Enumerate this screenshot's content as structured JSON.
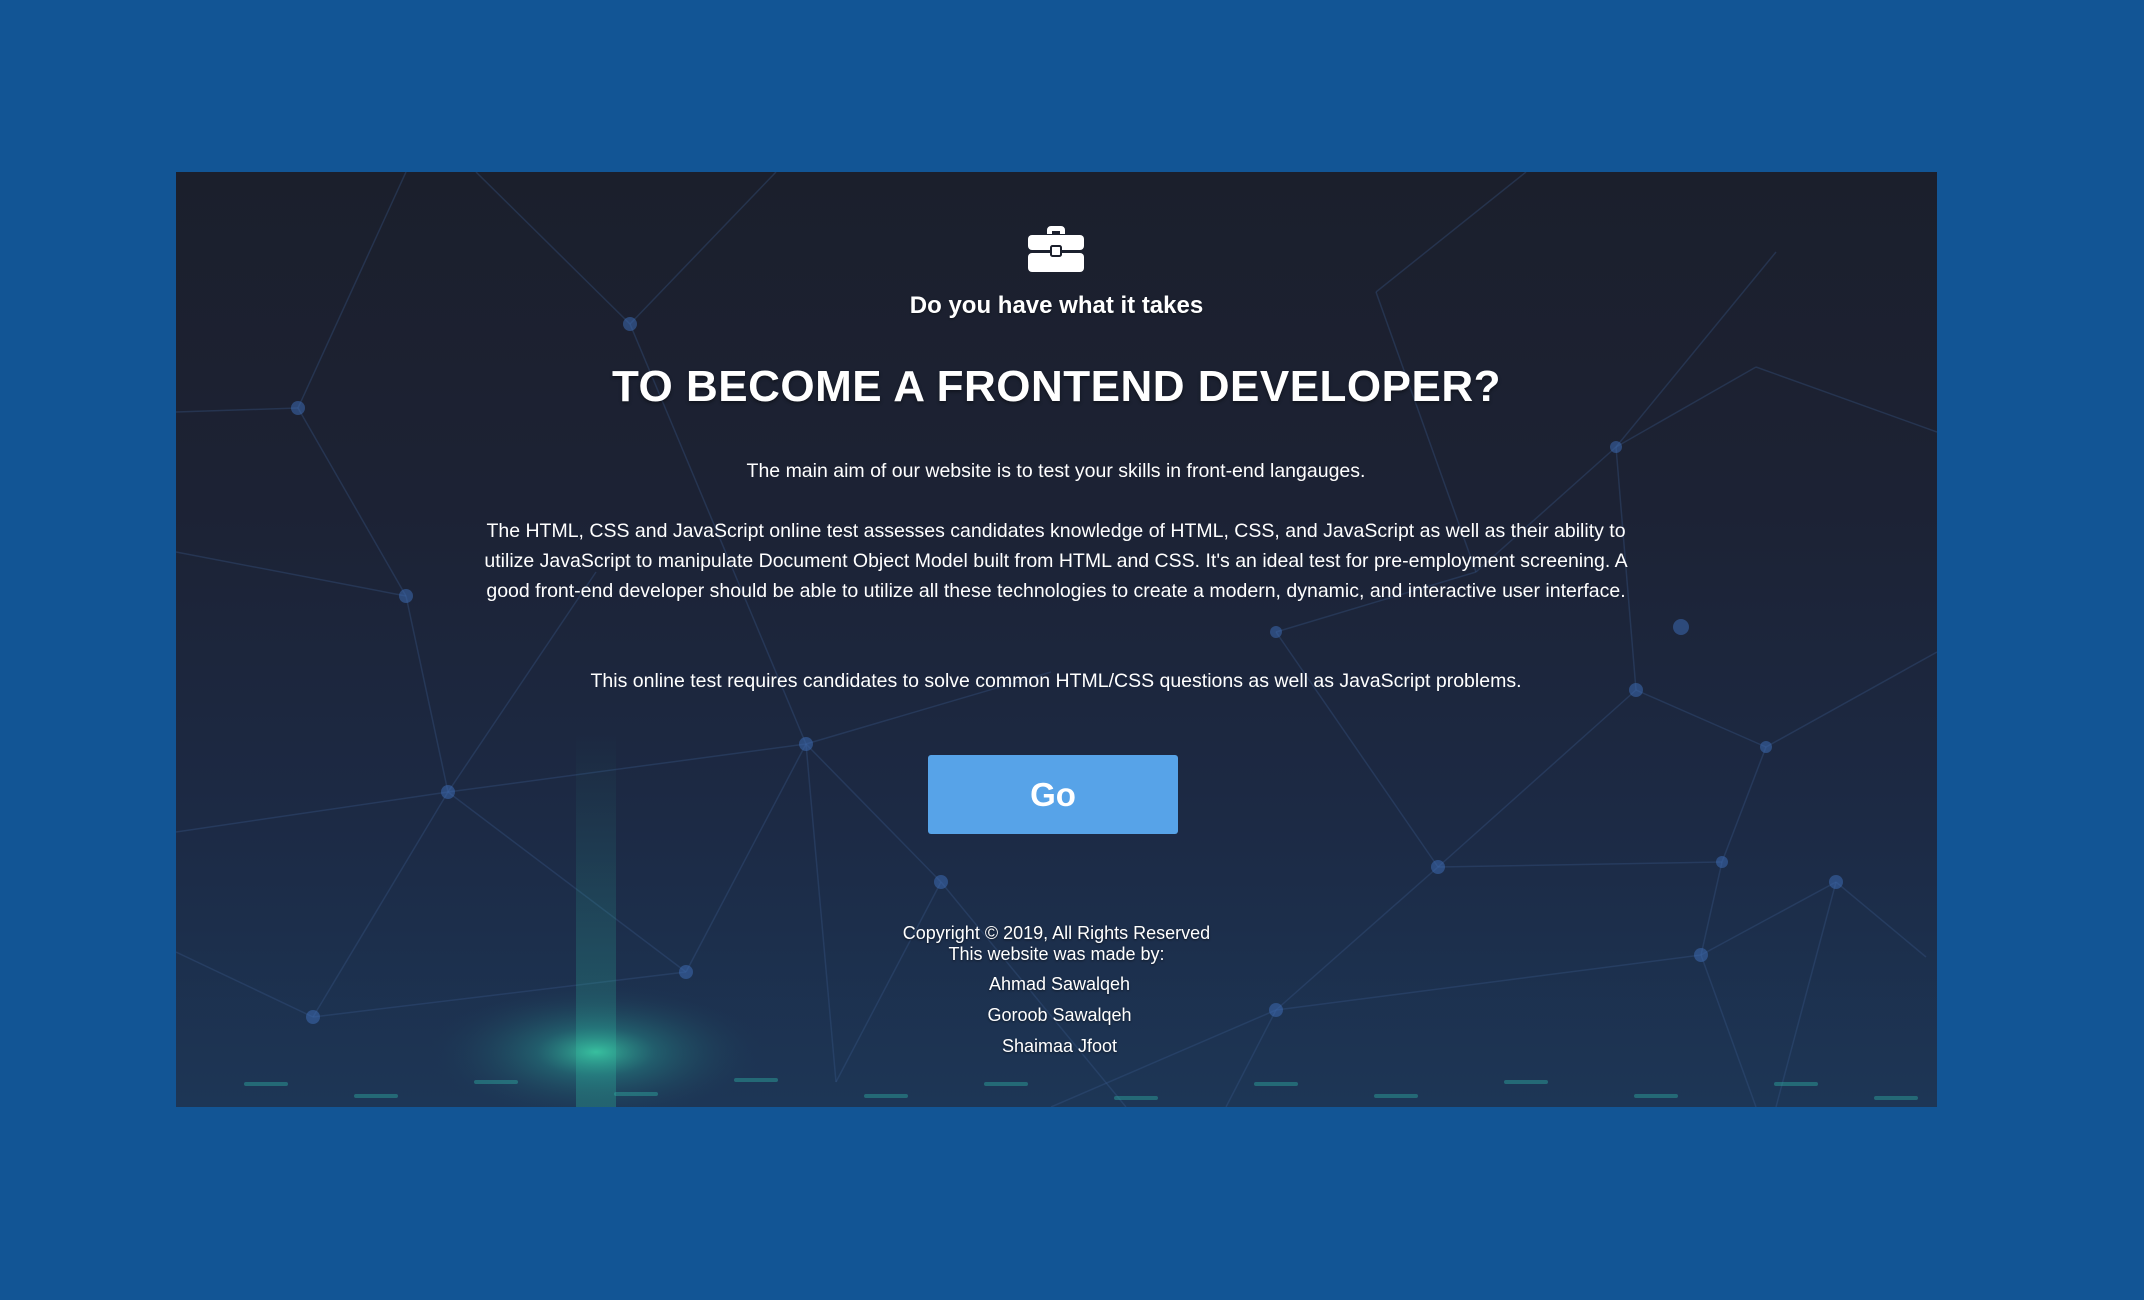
{
  "colors": {
    "page_background": "#125595",
    "panel_background": "#1c2234",
    "button_background": "#57a3e8",
    "text": "#ffffff"
  },
  "hero": {
    "icon": "briefcase-icon",
    "subtitle": "Do you have what it takes",
    "headline": "TO BECOME A FRONTEND DEVELOPER?",
    "paragraphs": [
      "The main aim of our website is to test your skills in front-end langauges.",
      "The HTML, CSS and JavaScript online test assesses candidates knowledge of HTML, CSS, and JavaScript as well as their ability to utilize JavaScript to manipulate Document Object Model built from HTML and CSS. It's an ideal test for pre-employment screening. A good front-end developer should be able to utilize all these technologies to create a modern, dynamic, and interactive user interface.",
      "This online test requires candidates to solve common HTML/CSS questions as well as JavaScript problems."
    ],
    "button_label": "Go"
  },
  "footer": {
    "copyright": "Copyright © 2019, All Rights Reserved",
    "made_by": "This website was made by:",
    "authors": [
      "Ahmad Sawalqeh",
      "Goroob Sawalqeh",
      "Shaimaa Jfoot"
    ]
  }
}
